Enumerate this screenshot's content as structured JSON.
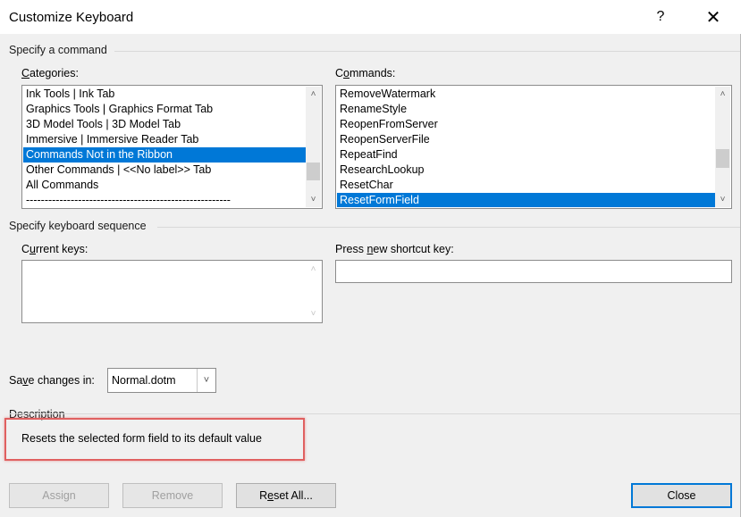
{
  "window": {
    "title": "Customize Keyboard",
    "help_glyph": "?",
    "close_glyph": "✕"
  },
  "specify_command": {
    "section_label": "Specify a command",
    "categories_label_prefix": "",
    "categories_label_mnemonic": "C",
    "categories_label_rest": "ategories:",
    "categories": [
      "Ink Tools | Ink Tab",
      "Graphics Tools | Graphics Format Tab",
      "3D Model Tools | 3D Model Tab",
      "Immersive | Immersive Reader Tab",
      "Commands Not in the Ribbon",
      "Other Commands | <<No label>> Tab",
      "All Commands",
      "-------------------------------------------------------"
    ],
    "categories_selected_index": 4,
    "commands_label_prefix": "C",
    "commands_label_mnemonic": "o",
    "commands_label_rest": "mmands:",
    "commands": [
      "RemoveWatermark",
      "RenameStyle",
      "ReopenFromServer",
      "ReopenServerFile",
      "RepeatFind",
      "ResearchLookup",
      "ResetChar",
      "ResetFormField"
    ],
    "commands_selected_index": 7
  },
  "keyboard_sequence": {
    "section_label": "Specify keyboard sequence",
    "current_keys_label_prefix": "C",
    "current_keys_label_mnemonic": "u",
    "current_keys_label_rest": "rrent keys:",
    "press_new_label_prefix": "Press ",
    "press_new_label_mnemonic": "n",
    "press_new_label_rest": "ew shortcut key:",
    "press_new_value": ""
  },
  "save_changes": {
    "label_prefix": "Sa",
    "label_mnemonic": "v",
    "label_rest": "e changes in:",
    "selected": "Normal.dotm"
  },
  "description": {
    "section_label": "Description",
    "text": "Resets the selected form field to its default value"
  },
  "buttons": {
    "assign": "Assign",
    "remove": "Remove",
    "reset_all_prefix": "R",
    "reset_all_mnemonic": "e",
    "reset_all_rest": "set All...",
    "close": "Close"
  },
  "colors": {
    "selection": "#0078d7",
    "highlight_box": "#e06060",
    "dialog_bg": "#f0f0f0"
  },
  "icons": {
    "scroll_up": "up-arrow",
    "scroll_down": "down-arrow",
    "dropdown": "chevron-down"
  }
}
